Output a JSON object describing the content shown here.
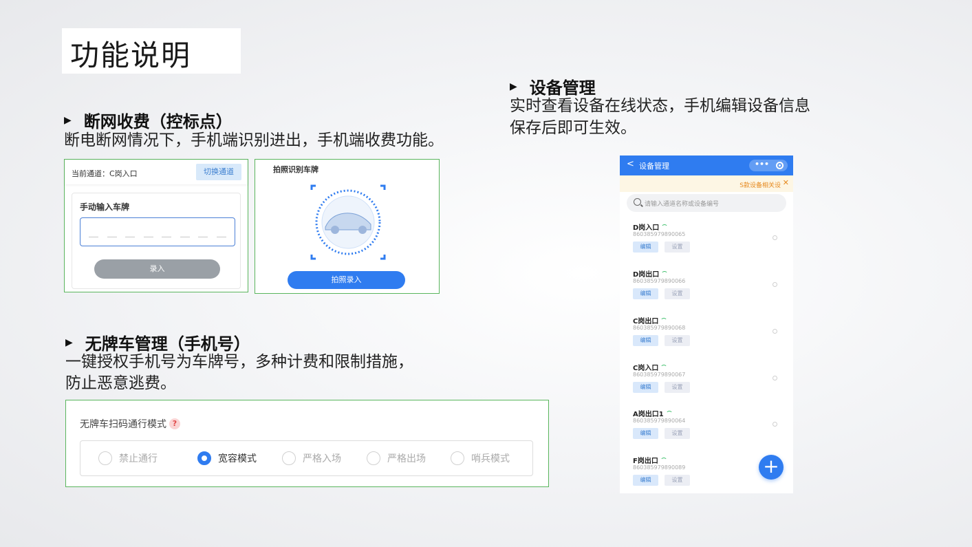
{
  "page_title": "功能说明",
  "sections": {
    "offline": {
      "heading": "断网收费（控标点）",
      "desc": "断电断网情况下，手机端识别进出，手机端收费功能。"
    },
    "no_plate": {
      "heading": "无牌车管理（手机号）",
      "desc_line1": "一键授权手机号为车牌号，多种计费和限制措施，",
      "desc_line2": "防止恶意逃费。"
    },
    "device_mgmt": {
      "heading": "设备管理",
      "desc_line1": "实时查看设备在线状态，手机编辑设备信息",
      "desc_line2": "保存后即可生效。"
    }
  },
  "manual_panel": {
    "current_channel": "当前通道：C岗入口",
    "switch_label": "切换通道",
    "card_title": "手动输入车牌",
    "submit_label": "录入"
  },
  "photo_panel": {
    "title": "拍照识别车牌",
    "shoot_label": "拍照录入"
  },
  "mode_panel": {
    "label": "无牌车扫码通行模式",
    "help": "?",
    "options": [
      "禁止通行",
      "宽容模式",
      "严格入场",
      "严格出场",
      "哨兵模式"
    ],
    "selected": "宽容模式"
  },
  "phone": {
    "title": "设备管理",
    "back": "<",
    "more": "•••",
    "notice": "S款设备相关设",
    "notice_close": "✕",
    "search_placeholder": "请输入通道名称或设备编号",
    "edit_label": "编辑",
    "set_label": "设置",
    "devices": [
      {
        "name": "D岗入口",
        "code": "860385979890065"
      },
      {
        "name": "D岗出口",
        "code": "860385979890066"
      },
      {
        "name": "C岗出口",
        "code": "860385979890068"
      },
      {
        "name": "C岗入口",
        "code": "860385979890067"
      },
      {
        "name": "A岗出口1",
        "code": "860385979890064"
      },
      {
        "name": "F岗出口",
        "code": "860385979890089"
      }
    ],
    "fab": "+"
  }
}
